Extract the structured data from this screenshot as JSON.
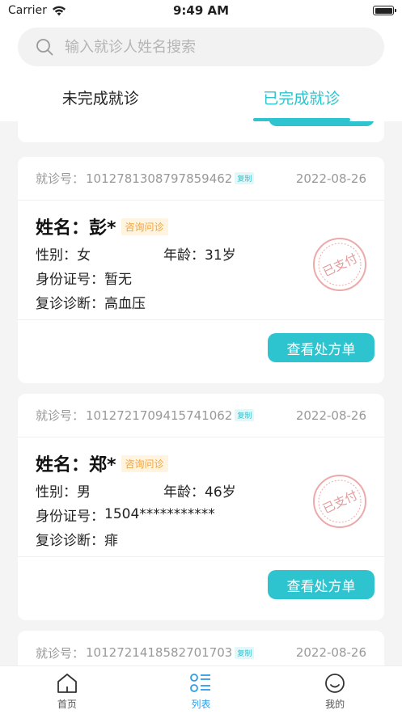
{
  "status_bar": {
    "carrier": "Carrier",
    "time": "9:49 AM"
  },
  "search": {
    "placeholder": "输入就诊人姓名搜索",
    "value": ""
  },
  "tabs": [
    {
      "label": "未完成就诊",
      "active": false
    },
    {
      "label": "已完成就诊",
      "active": true
    }
  ],
  "labels": {
    "visit_no": "就诊号：",
    "copy": "复制",
    "name": "姓名：",
    "gender": "性别：",
    "age": "年龄：",
    "id_no": "身份证号：",
    "diagnosis": "复诊诊断：",
    "prescription_button": "查看处方单",
    "stamp": "已支付"
  },
  "records": [
    {
      "visit_no": "1012781308797859462",
      "date": "2022-08-26",
      "name": "彭*",
      "badge": "咨询问诊",
      "gender": "女",
      "age": "31岁",
      "id_no": "暂无",
      "diagnosis": "高血压"
    },
    {
      "visit_no": "1012721709415741062",
      "date": "2022-08-26",
      "name": "郑*",
      "badge": "咨询问诊",
      "gender": "男",
      "age": "46岁",
      "id_no": "1504***********",
      "diagnosis": "痱"
    },
    {
      "visit_no": "1012721418582701703",
      "date": "2022-08-26"
    }
  ],
  "bottom_nav": [
    {
      "label": "首页",
      "icon": "home-icon",
      "active": false
    },
    {
      "label": "列表",
      "icon": "list-icon",
      "active": true
    },
    {
      "label": "我的",
      "icon": "profile-icon",
      "active": false
    }
  ],
  "colors": {
    "accent": "#2ec4cf",
    "nav_active": "#2f9de6",
    "badge": "#f0a33a",
    "stamp": "#e8a0a0"
  }
}
